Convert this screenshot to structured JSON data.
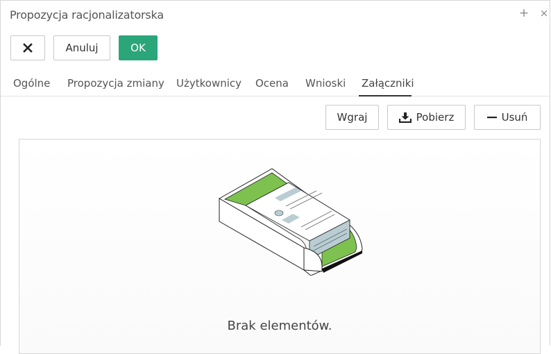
{
  "window": {
    "title": "Propozycja racjonalizatorska",
    "add_glyph": "+",
    "close_glyph": "×"
  },
  "toolbar": {
    "close_glyph": "✕",
    "cancel_label": "Anuluj",
    "ok_label": "OK",
    "ok_color": "#2aa67a"
  },
  "tabs": [
    {
      "label": "Ogólne",
      "active": false
    },
    {
      "label": "Propozycja zmiany",
      "active": false
    },
    {
      "label": "Użytkownicy",
      "active": false
    },
    {
      "label": "Ocena",
      "active": false
    },
    {
      "label": "Wnioski",
      "active": false
    },
    {
      "label": "Załączniki",
      "active": true
    }
  ],
  "attachments": {
    "upload_label": "Wgraj",
    "download_label": "Pobierz",
    "download_icon": "download-icon",
    "delete_label": "Usuń",
    "delete_icon": "minus-icon",
    "empty_text": "Brak elementów.",
    "illustration_accent": "#7dc24f"
  }
}
